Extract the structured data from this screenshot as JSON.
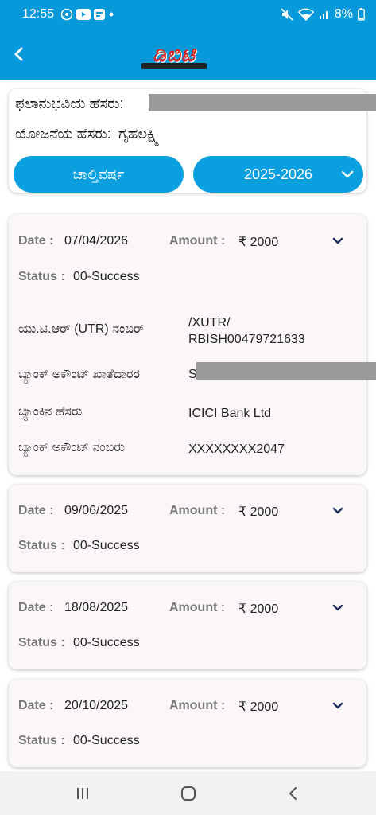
{
  "status_bar": {
    "time": "12:55",
    "battery": "8%"
  },
  "beneficiary": {
    "label": "ಫಲಾನುಭವಿಯ ಹೆಸರು:",
    "scheme_label": "ಯೋಜನೆಯ ಹೆಸರು:",
    "scheme_name": "ಗೃಹಲಕ್ಷ್ಮಿ"
  },
  "filters": {
    "current_year_label": "ಚಾಲ್ತಿವರ್ಷ",
    "year_value": "2025-2026"
  },
  "labels": {
    "date": "Date :",
    "amount": "Amount :",
    "status": "Status :",
    "utr": "ಯು.ಟಿ.ಆರ್ (UTR) ನಂಬರ್",
    "account_holder": "ಬ್ಯಾಂಕ್ ಅಕೌಂಟ್ ಖಾತೆದಾರರ",
    "bank_name": "ಬ್ಯಾಂಕಿನ ಹೆಸರು",
    "account_number": "ಬ್ಯಾಂಕ್ ಅಕೌಂಟ್ ನಂಬರು"
  },
  "transactions": [
    {
      "date": "07/04/2026",
      "amount": "₹ 2000",
      "status": "00-Success",
      "utr_line1": "/XUTR/",
      "utr_line2": "RBISH00479721633",
      "holder_initial": "S",
      "bank_name": "ICICI Bank Ltd",
      "account_number": "XXXXXXXX2047"
    },
    {
      "date": "09/06/2025",
      "amount": "₹ 2000",
      "status": "00-Success"
    },
    {
      "date": "18/08/2025",
      "amount": "₹ 2000",
      "status": "00-Success"
    },
    {
      "date": "20/10/2025",
      "amount": "₹ 2000",
      "status": "00-Success"
    }
  ],
  "icons": {
    "back": "arrow-left-icon",
    "chevron": "chevron-down-icon",
    "recents": "recent-apps-icon",
    "home": "home-icon",
    "nav_back": "nav-back-icon"
  },
  "colors": {
    "primary": "#0799d9",
    "pill": "#0aa0e0",
    "chevron": "#1c2a5c",
    "card_bg": "#fbf7f7"
  }
}
